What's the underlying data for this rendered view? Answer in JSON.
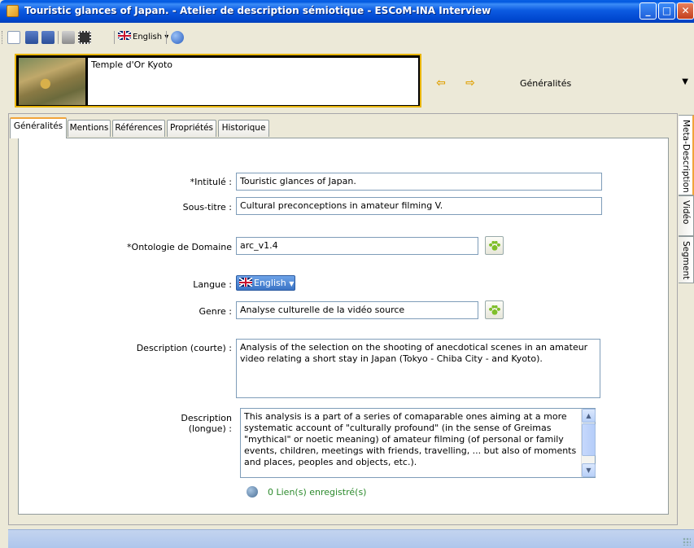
{
  "window": {
    "title": "Touristic glances of Japan. - Atelier de description sémiotique - ESCoM-INA Interview",
    "controls": [
      "minimize",
      "maximize",
      "close"
    ]
  },
  "toolbar": {
    "language_label": "English",
    "icons": [
      "new-icon",
      "save-icon",
      "save-as-icon",
      "print-icon",
      "film-icon",
      "help-icon"
    ]
  },
  "media": {
    "title": "Temple d'Or Kyoto"
  },
  "section_select": {
    "value": "Généralités"
  },
  "tabs": [
    {
      "label": "Généralités",
      "active": true
    },
    {
      "label": "Mentions"
    },
    {
      "label": "Références"
    },
    {
      "label": "Propriétés"
    },
    {
      "label": "Historique"
    }
  ],
  "side_tabs": [
    {
      "label": "Meta-Description",
      "active": true
    },
    {
      "label": "Vidéo"
    },
    {
      "label": "Segment"
    }
  ],
  "form": {
    "intitule_label": "*Intitulé :",
    "intitule_value": "Touristic glances of Japan.",
    "sous_titre_label": "Sous-titre :",
    "sous_titre_value": "Cultural preconceptions in amateur filming V.",
    "ontologie_label": "*Ontologie de Domaine",
    "ontologie_value": "arc_v1.4",
    "langue_label": "Langue :",
    "langue_value": "English",
    "genre_label": "Genre :",
    "genre_value": "Analyse culturelle de la vidéo source",
    "desc_courte_label": "Description (courte) :",
    "desc_courte_value": "Analysis of the selection on the shooting of anecdotical scenes in an amateur video relating a short stay in Japan (Tokyo - Chiba City - and Kyoto).",
    "desc_longue_label_1": "Description",
    "desc_longue_label_2": "(longue) :",
    "desc_longue_value": "This analysis is a part of a series of comaparable ones aiming at a more systematic account of \"culturally profound\" (in the sense of Greimas \"mythical\" or noetic meaning) of amateur filming (of personal or family events, children, meetings with friends, travelling, ... but also of moments and places, peoples and objects, etc.).\n\nIn this analysis, we are interested of the \"pro-filmic scenes\", the (anonymous)",
    "links_label": "0 Lien(s) enregistré(s)"
  },
  "colors": {
    "title_bar": "#0058e0",
    "tab_accent": "#f1a43a",
    "thumb_border": "#e8b400",
    "links_text": "#2c8a2c"
  }
}
